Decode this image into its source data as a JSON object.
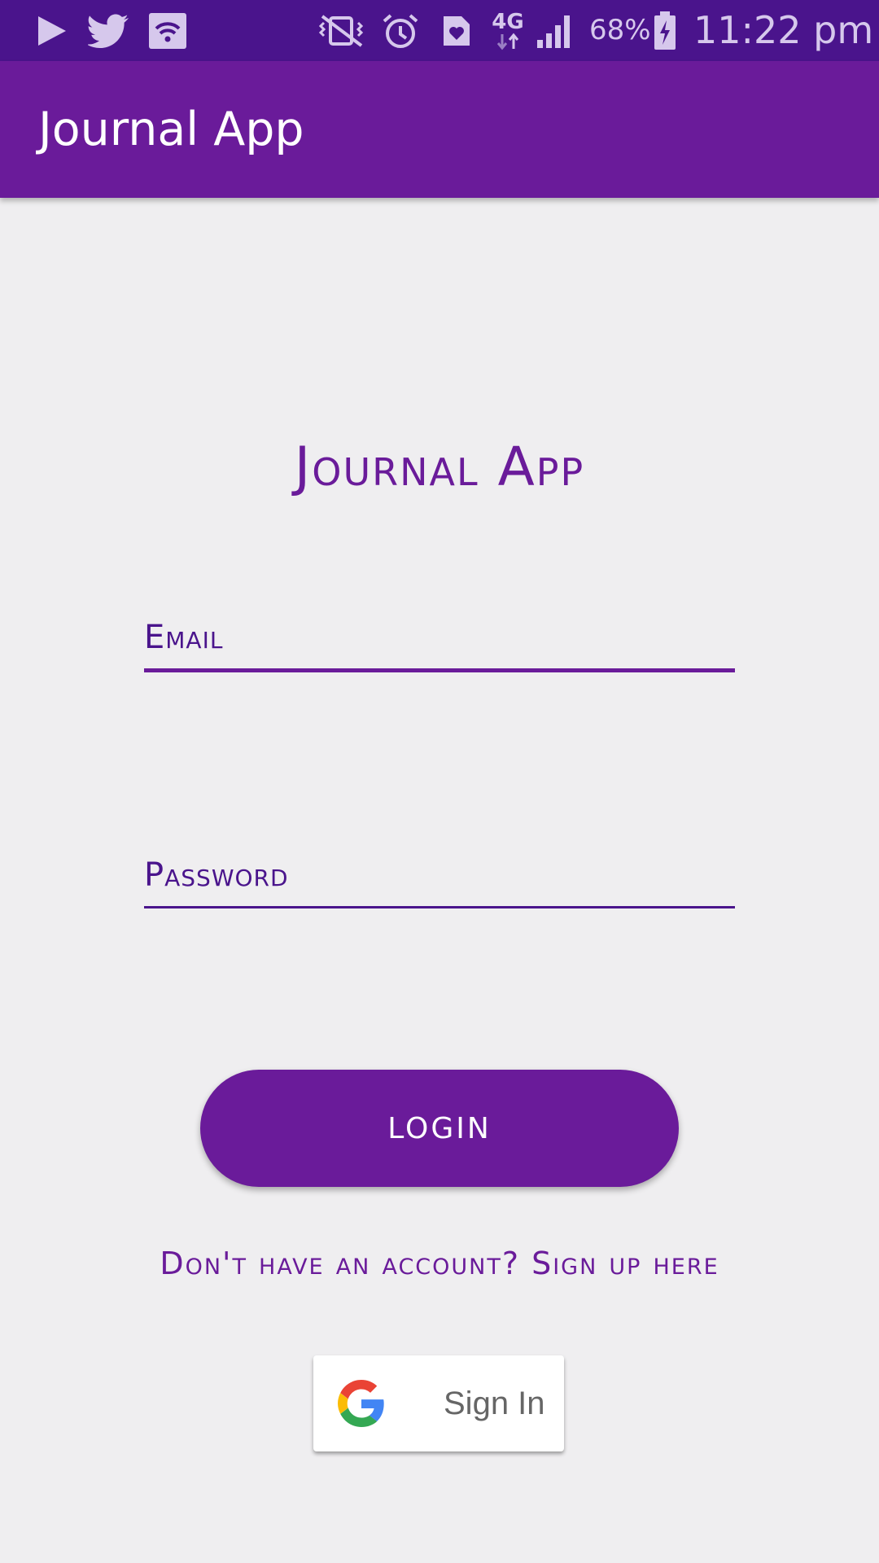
{
  "status_bar": {
    "battery": "68%",
    "time": "11:22 pm",
    "network": "4G",
    "icons": [
      "play-icon",
      "twitter-icon",
      "wifi-icon",
      "vibrate-off-icon",
      "alarm-icon",
      "health-icon",
      "network-4g-icon",
      "signal-icon",
      "battery-charging-icon"
    ]
  },
  "app_bar": {
    "title": "Journal App"
  },
  "login": {
    "heading": "Journal App",
    "email_placeholder": "Email",
    "password_placeholder": "Password",
    "login_button": "LOGIN",
    "signup_link": "Don't have an account? Sign up here",
    "google_button": "Sign In"
  },
  "colors": {
    "primary": "#6a1b9a",
    "primary_dark": "#4a148c",
    "background": "#efeef0"
  }
}
